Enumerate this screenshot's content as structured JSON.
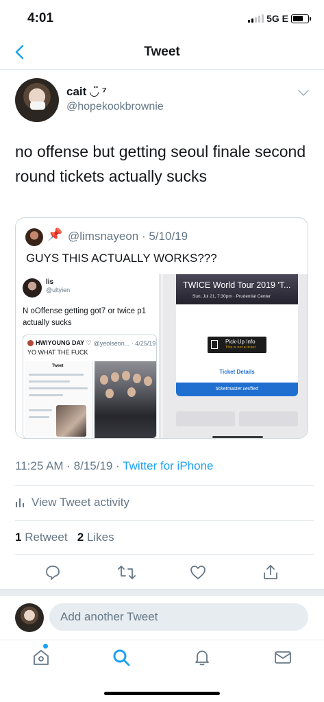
{
  "status_bar": {
    "time": "4:01",
    "network": "5G E"
  },
  "nav": {
    "title": "Tweet"
  },
  "tweet": {
    "display_name": "cait ◡̈ ⁷",
    "username": "@hopekookbrownie",
    "text": "no offense but getting seoul finale second round tickets actually sucks",
    "timestamp": "11:25 AM · 8/15/19 · ",
    "source": "Twitter for iPhone"
  },
  "quote": {
    "handle": "@limsnayeon · 5/10/19",
    "text": "GUYS THIS ACTUALLY WORKS???",
    "media": {
      "mini_tweet": {
        "name": "lis",
        "handle": "@ultyien",
        "text": "N oOffense getting got7 or twice p1 actually sucks",
        "quoted_name": "HWIYOUNG DAY ♡",
        "quoted_meta": "@yeolseon... · 4/25/19",
        "quoted_text": "YO WHAT THE FUCK",
        "inner_title": "Tweet"
      },
      "ticket": {
        "title": "TWICE World Tour 2019 'T...",
        "subtitle": "Sun, Jul 21, 7:30pm · Prudential Center",
        "pickup_label": "Pick-Up Info",
        "pickup_sub": "This is not a ticket",
        "details_label": "Ticket Details",
        "verified_label": "ticketmaster.verified"
      }
    }
  },
  "activity": {
    "label": "View Tweet activity"
  },
  "stats": {
    "retweets_count": "1",
    "retweets_label": "Retweet",
    "likes_count": "2",
    "likes_label": "Likes"
  },
  "reply": {
    "placeholder": "Add another Tweet"
  },
  "icons": {
    "back": "chevron-left-icon",
    "caret": "chevron-down-icon",
    "reply": "reply-icon",
    "retweet": "retweet-icon",
    "like": "heart-icon",
    "share": "share-icon",
    "home": "home-icon",
    "search": "search-icon",
    "notifications": "bell-icon",
    "messages": "mail-icon"
  },
  "colors": {
    "accent": "#1da1f2",
    "secondary_text": "#657786",
    "border": "#e1e8ed"
  }
}
